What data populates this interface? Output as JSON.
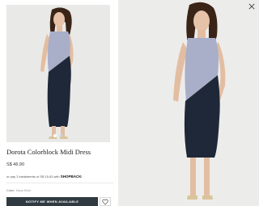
{
  "product": {
    "title": "Dorota Colorblock Midi Dress",
    "price": "S$ 46.90",
    "installment_text": "or pay 3 instalments of S$ 15.63 with",
    "installment_brand": "SHOPBACK",
    "installment_suffix": "/",
    "color_label": "Color:",
    "color_value": "Navy Blue"
  },
  "actions": {
    "notify_label": "NOTIFY ME WHEN AVAILABLE"
  },
  "gallery": {
    "dot_count": 2,
    "active_dot": 0
  },
  "icons": {
    "wishlist": "heart-icon",
    "close": "close-icon"
  },
  "colors": {
    "button_bg": "#2f3a41",
    "dress_light": "#a9aec9",
    "dress_dark": "#1f2838"
  }
}
